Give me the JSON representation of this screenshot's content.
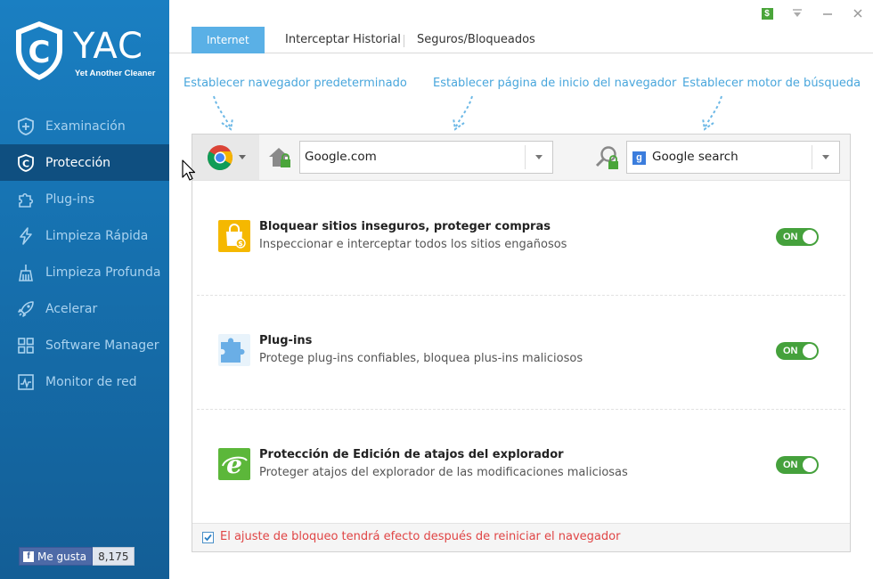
{
  "app": {
    "logo_text": "YAC",
    "logo_sub": "Yet Another Cleaner"
  },
  "sidebar": {
    "items": [
      {
        "label": "Examinación",
        "icon": "plus-shield-icon",
        "active": false
      },
      {
        "label": "Protección",
        "icon": "shield-icon",
        "active": true
      },
      {
        "label": "Plug-ins",
        "icon": "puzzle-icon",
        "active": false
      },
      {
        "label": "Limpieza Rápida",
        "icon": "lightning-icon",
        "active": false
      },
      {
        "label": "Limpieza Profunda",
        "icon": "broom-icon",
        "active": false
      },
      {
        "label": "Acelerar",
        "icon": "rocket-icon",
        "active": false
      },
      {
        "label": "Software Manager",
        "icon": "grid-icon",
        "active": false
      },
      {
        "label": "Monitor de red",
        "icon": "monitor-icon",
        "active": false
      }
    ],
    "like_label": "Me gusta",
    "like_count": "8,175"
  },
  "window": {
    "icons": [
      "dollar-icon",
      "menu-down-icon",
      "minimize-icon",
      "close-icon"
    ]
  },
  "tabs": [
    {
      "label": "Internet",
      "active": true
    },
    {
      "label": "Interceptar Historial",
      "active": false
    },
    {
      "label": "Seguros/Bloqueados",
      "active": false
    }
  ],
  "hints": {
    "browser": "Establecer navegador predeterminado",
    "homepage": "Establecer página de inicio del navegador",
    "search": "Establecer motor de búsqueda"
  },
  "toolbar": {
    "homepage_value": "Google.com",
    "search_value": "Google search"
  },
  "rows": [
    {
      "title": "Bloquear sitios inseguros, proteger compras",
      "desc": "Inspeccionar e interceptar todos los sitios engañosos",
      "icon": "shopping-bag-icon",
      "toggle": "ON"
    },
    {
      "title": "Plug-ins",
      "desc": "Protege plug-ins confiables, bloquea  plus-ins maliciosos",
      "icon": "puzzle-icon",
      "toggle": "ON"
    },
    {
      "title": "Protección de Edición de atajos del explorador",
      "desc": "Proteger atajos del explorador de las modificaciones maliciosas",
      "icon": "browser-e-icon",
      "toggle": "ON"
    }
  ],
  "footer": {
    "checked": true,
    "text": "El ajuste de bloqueo tendrá efecto después de reiniciar el navegador"
  },
  "colors": {
    "sidebar": "#1670ae",
    "sidebar_active": "#0f4f80",
    "accent": "#5ab0e6",
    "hint": "#48a6dc",
    "toggle_on": "#45a13c",
    "warning_text": "#e04545"
  }
}
